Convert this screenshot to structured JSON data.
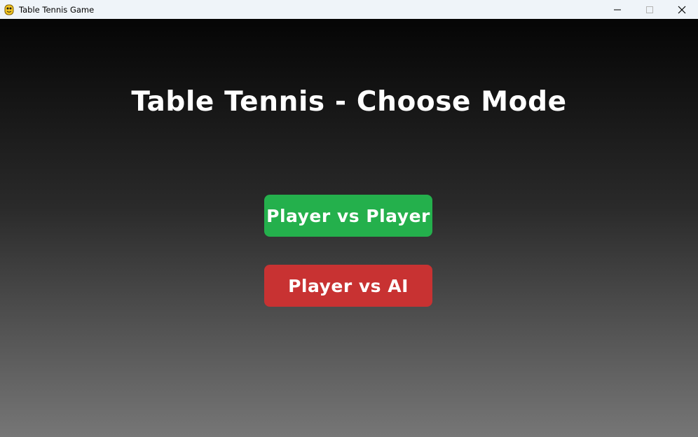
{
  "window": {
    "title": "Table Tennis Game",
    "app_icon": "python-snake-icon"
  },
  "window_controls": {
    "minimize_icon": "minimize-icon",
    "maximize_icon": "maximize-icon",
    "close_icon": "close-icon"
  },
  "menu": {
    "heading": "Table Tennis - Choose Mode",
    "buttons": [
      {
        "label": "Player vs Player",
        "color": "#24b04c"
      },
      {
        "label": "Player vs AI",
        "color": "#c83232"
      }
    ]
  },
  "colors": {
    "background_top": "#050505",
    "background_bottom": "#767676",
    "text": "#ffffff",
    "titlebar": "#eff4f9"
  }
}
